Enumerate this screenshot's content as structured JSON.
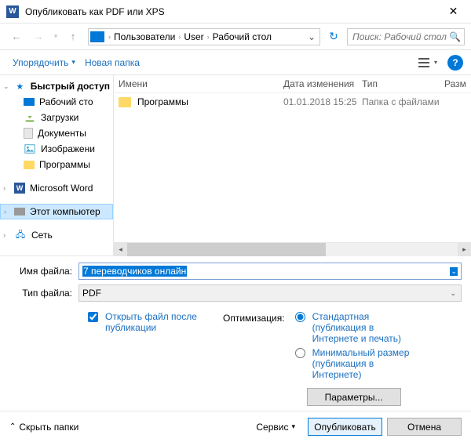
{
  "window": {
    "title": "Опубликовать как PDF или XPS"
  },
  "nav": {
    "crumbs": [
      "Пользователи",
      "User",
      "Рабочий стол"
    ],
    "search_placeholder": "Поиск: Рабочий стол"
  },
  "toolbar": {
    "organize": "Упорядочить",
    "new_folder": "Новая папка"
  },
  "sidebar": {
    "items": [
      {
        "label": "Быстрый доступ",
        "icon": "star",
        "expander": "v"
      },
      {
        "label": "Рабочий сто",
        "icon": "desktop"
      },
      {
        "label": "Загрузки",
        "icon": "dl"
      },
      {
        "label": "Документы",
        "icon": "doc"
      },
      {
        "label": "Изображени",
        "icon": "pic"
      },
      {
        "label": "Программы",
        "icon": "folder"
      },
      {
        "label": "Microsoft Word",
        "icon": "word",
        "expander": ">"
      },
      {
        "label": "Этот компьютер",
        "icon": "pc",
        "selected": true,
        "expander": ">"
      },
      {
        "label": "Сеть",
        "icon": "net",
        "expander": ">"
      }
    ]
  },
  "columns": {
    "name": "Имени",
    "date": "Дата изменения",
    "type": "Тип",
    "size": "Разм"
  },
  "rows": [
    {
      "name": "Программы",
      "date": "01.01.2018 15:25",
      "type": "Папка с файлами"
    }
  ],
  "form": {
    "filename_label": "Имя файла:",
    "filename_value": "7 переводчиков онлайн",
    "filetype_label": "Тип файла:",
    "filetype_value": "PDF",
    "open_after": "Открыть файл после публикации",
    "optimization_label": "Оптимизация:",
    "opt_standard": "Стандартная (публикация в Интернете и печать)",
    "opt_minimal": "Минимальный размер (публикация в Интернете)",
    "params_btn": "Параметры..."
  },
  "footer": {
    "hide_folders": "Скрыть папки",
    "service": "Сервис",
    "publish": "Опубликовать",
    "cancel": "Отмена"
  }
}
